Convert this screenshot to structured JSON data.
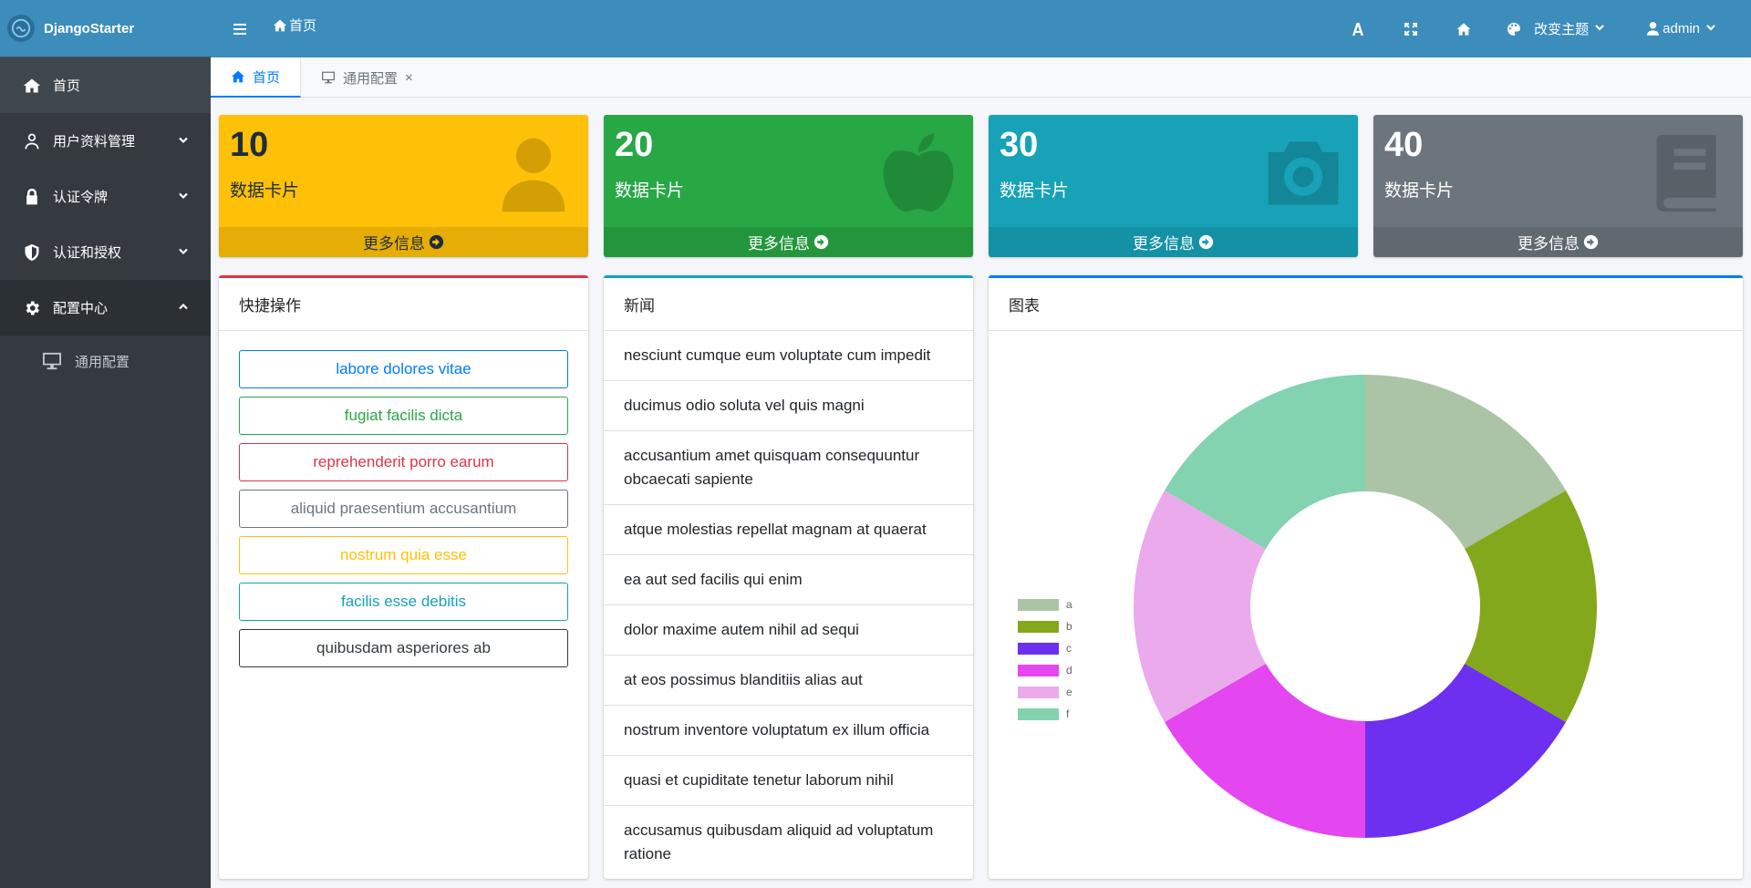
{
  "brand": {
    "name": "DjangoStarter"
  },
  "sidebar": {
    "items": [
      {
        "label": "首页",
        "icon": "home-icon"
      },
      {
        "label": "用户资料管理",
        "icon": "user-icon"
      },
      {
        "label": "认证令牌",
        "icon": "lock-icon"
      },
      {
        "label": "认证和授权",
        "icon": "shield-icon"
      },
      {
        "label": "配置中心",
        "icon": "gear-icon"
      }
    ],
    "subitems": [
      {
        "label": "通用配置",
        "icon": "monitor-icon"
      }
    ]
  },
  "topbar": {
    "home_label": "首页",
    "theme_label": "改变主题",
    "user_label": "admin"
  },
  "tabs": [
    {
      "label": "首页",
      "icon": "home-icon"
    },
    {
      "label": "通用配置",
      "icon": "monitor-icon",
      "close": "×"
    }
  ],
  "cards": [
    {
      "value": "10",
      "label": "数据卡片",
      "more": "更多信息",
      "icon": "user-icon",
      "color": "#ffc107"
    },
    {
      "value": "20",
      "label": "数据卡片",
      "more": "更多信息",
      "icon": "apple-icon",
      "color": "#28a745"
    },
    {
      "value": "30",
      "label": "数据卡片",
      "more": "更多信息",
      "icon": "camera-icon",
      "color": "#17a2b8"
    },
    {
      "value": "40",
      "label": "数据卡片",
      "more": "更多信息",
      "icon": "book-icon",
      "color": "#6c757d"
    }
  ],
  "quick_actions": {
    "title": "快捷操作",
    "buttons": [
      {
        "label": "labore dolores vitae",
        "color": "#007bff"
      },
      {
        "label": "fugiat facilis dicta",
        "color": "#28a745"
      },
      {
        "label": "reprehenderit porro earum",
        "color": "#dc3545"
      },
      {
        "label": "aliquid praesentium accusantium",
        "color": "#6c757d"
      },
      {
        "label": "nostrum quia esse",
        "color": "#ffc107"
      },
      {
        "label": "facilis esse debitis",
        "color": "#17a2b8"
      },
      {
        "label": "quibusdam asperiores ab",
        "color": "#343a40"
      }
    ]
  },
  "news": {
    "title": "新闻",
    "items": [
      "nesciunt cumque eum voluptate cum impedit",
      "ducimus odio soluta vel quis magni",
      "accusantium amet quisquam consequuntur obcaecati sapiente",
      "atque molestias repellat magnam at quaerat",
      "ea aut sed facilis qui enim",
      "dolor maxime autem nihil ad sequi",
      "at eos possimus blanditiis alias aut",
      "nostrum inventore voluptatum ex illum officia",
      "quasi et cupiditate tenetur laborum nihil",
      "accusamus quibusdam aliquid ad voluptatum ratione"
    ]
  },
  "chart_panel": {
    "title": "图表"
  },
  "chart_data": {
    "type": "pie",
    "donut": true,
    "title": "",
    "categories": [
      "a",
      "b",
      "c",
      "d",
      "e",
      "f"
    ],
    "values": [
      1,
      1,
      1,
      1,
      1,
      1
    ],
    "colors": [
      "#abc4a5",
      "#84a81c",
      "#6d2ff0",
      "#e446f0",
      "#eaaaec",
      "#83d2b0"
    ],
    "legend": "left"
  }
}
